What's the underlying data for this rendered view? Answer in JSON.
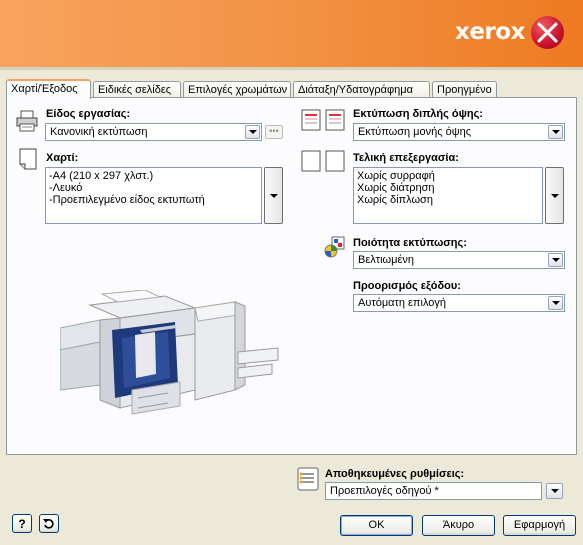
{
  "brand": {
    "logo_text": "xerox"
  },
  "tabs": [
    {
      "label": "Χαρτί/Έξοδος",
      "active": true
    },
    {
      "label": "Ειδικές σελίδες"
    },
    {
      "label": "Επιλογές χρωμάτων"
    },
    {
      "label": "Διάταξη/Υδατογράφημα"
    },
    {
      "label": "Προηγμένο"
    }
  ],
  "job_type": {
    "label": "Είδος εργασίας:",
    "value": "Κανονική εκτύπωση",
    "more": "•••"
  },
  "paper": {
    "label": "Χαρτί:",
    "items": [
      "-A4 (210 x 297 χλστ.)",
      "-Λευκό",
      "-Προεπιλεγμένο είδος εκτυπωτή"
    ]
  },
  "duplex": {
    "label": "Εκτύπωση διπλής όψης:",
    "value": "Εκτύπωση μονής όψης"
  },
  "finishing": {
    "label": "Τελική επεξεργασία:",
    "items": [
      "Χωρίς συρραφή",
      "Χωρίς διάτρηση",
      "Χωρίς δίπλωση"
    ]
  },
  "print_quality": {
    "label": "Ποιότητα εκτύπωσης:",
    "value": "Βελτιωμένη"
  },
  "output_destination": {
    "label": "Προορισμός εξόδου:",
    "value": "Αυτόματη επιλογή"
  },
  "saved_settings": {
    "label": "Αποθηκευμένες ρυθμίσεις:",
    "value": "Προεπιλογές οδηγού *"
  },
  "footer": {
    "help_glyph": "?",
    "ok": "OK",
    "cancel": "Άκυρο",
    "apply": "Εφαρμογή"
  },
  "colors": {
    "accent": "#f39447",
    "brand_red": "#c8102e",
    "dark_blue": "#1f3a7a"
  }
}
